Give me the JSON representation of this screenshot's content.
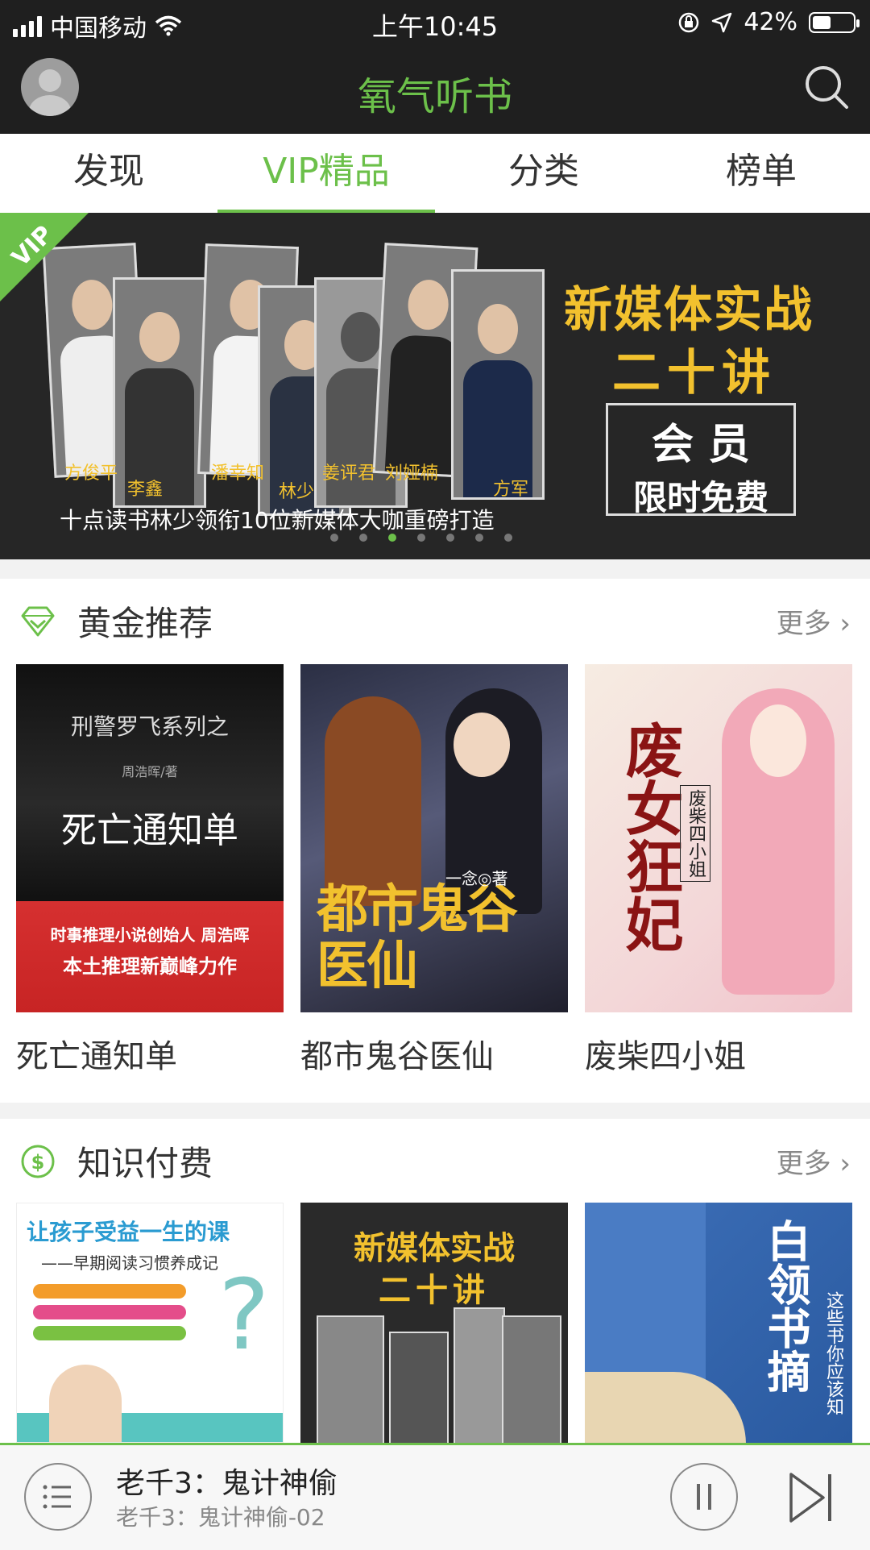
{
  "status": {
    "carrier": "中国移动",
    "time": "上午10:45",
    "battery": "42%"
  },
  "app": {
    "title": "氧气听书"
  },
  "tabs": [
    {
      "label": "发现"
    },
    {
      "label": "VIP精品"
    },
    {
      "label": "分类"
    },
    {
      "label": "榜单"
    }
  ],
  "banner": {
    "title_line1": "新媒体实战",
    "title_line2": "二十讲",
    "member_line1": "会 员",
    "member_line2": "限时免费",
    "tagline": "十点读书林少领衔10位新媒体大咖重磅打造",
    "people": [
      "方俊平",
      "李鑫",
      "潘幸知",
      "林少",
      "姜评君",
      "刘娅楠",
      "方军"
    ],
    "dots_total": 7,
    "dots_active": 3,
    "corner": "VIP"
  },
  "golden": {
    "title": "黄金推荐",
    "more": "更多 ›",
    "books": [
      {
        "title": "死亡通知单",
        "cover_top": "刑警罗飞系列之",
        "cover_author": "周浩晖/著",
        "cover_main": "死亡通知单",
        "cover_bottom1": "时事推理小说创始人 周浩晖",
        "cover_bottom2": "本土推理新巅峰力作"
      },
      {
        "title": "都市鬼谷医仙",
        "cover_main": "都市鬼谷医仙",
        "cover_author": "一念◎著"
      },
      {
        "title": "废柴四小姐",
        "cover_main": "废女狂妃",
        "cover_side": "废柴四小姐"
      }
    ]
  },
  "knowledge": {
    "title": "知识付费",
    "more": "更多 ›",
    "books": [
      {
        "cover_title": "让孩子受益一生的课",
        "cover_sub": "——早期阅读习惯养成记"
      },
      {
        "cover_title1": "新媒体实战",
        "cover_title2": "二十讲"
      },
      {
        "cover_title": "白领书摘",
        "cover_side": "这些书你应该知"
      }
    ]
  },
  "player": {
    "title": "老千3：鬼计神偷",
    "subtitle": "老千3：鬼计神偷-02"
  }
}
